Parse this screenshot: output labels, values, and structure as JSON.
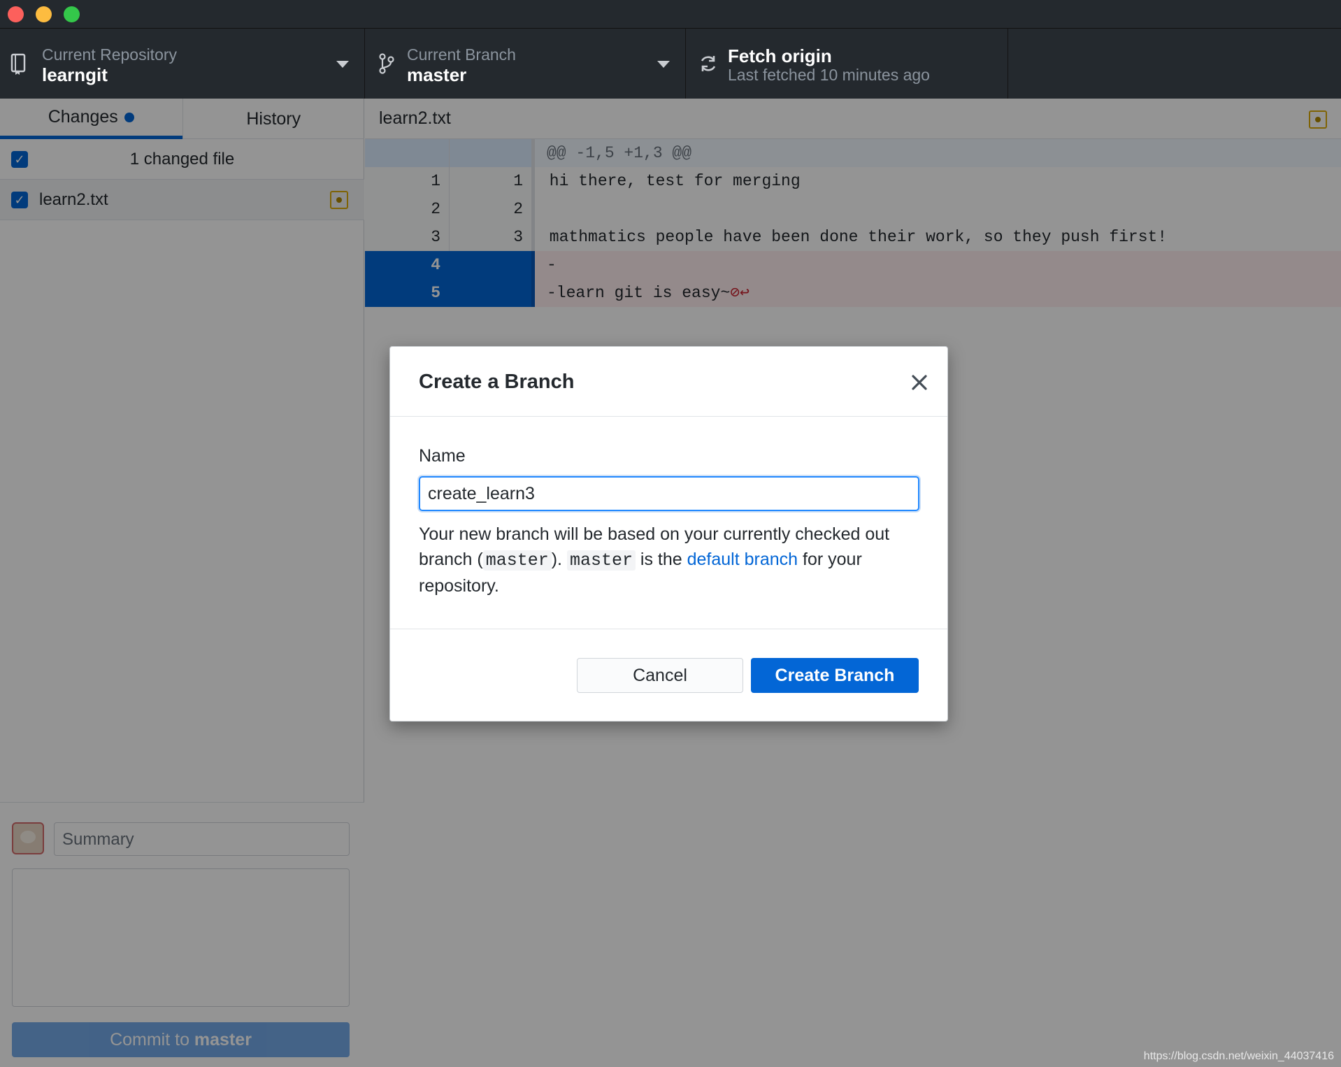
{
  "toolbar": {
    "repo_label": "Current Repository",
    "repo_value": "learngit",
    "branch_label": "Current Branch",
    "branch_value": "master",
    "fetch_title": "Fetch origin",
    "fetch_subtitle": "Last fetched 10 minutes ago"
  },
  "sidebar": {
    "tabs": [
      {
        "label": "Changes"
      },
      {
        "label": "History"
      }
    ],
    "changes_count": "1 changed file",
    "files": [
      {
        "name": "learn2.txt"
      }
    ],
    "summary_placeholder": "Summary",
    "commit_prefix": "Commit to ",
    "commit_branch": "master"
  },
  "diff": {
    "filename": "learn2.txt",
    "hunk": "@@ -1,5 +1,3 @@",
    "lines": [
      {
        "old": "1",
        "new": "1",
        "text": " hi there, test for merging"
      },
      {
        "old": "2",
        "new": "2",
        "text": ""
      },
      {
        "old": "3",
        "new": "3",
        "text": " mathmatics people have been done their work, so they push first!"
      },
      {
        "old": "4",
        "new": "",
        "text": "-"
      },
      {
        "old": "5",
        "new": "",
        "text": "-learn git is easy~"
      }
    ],
    "no_newline_marker": "⊘↩"
  },
  "dialog": {
    "title": "Create a Branch",
    "name_label": "Name",
    "name_value": "create_learn3",
    "help_1": "Your new branch will be based on your currently checked out branch (",
    "help_code_1": "master",
    "help_2": "). ",
    "help_code_2": "master",
    "help_3": " is the ",
    "help_link": "default branch",
    "help_4": " for your repository.",
    "cancel_label": "Cancel",
    "create_label": "Create Branch"
  },
  "watermark": "https://blog.csdn.net/weixin_44037416"
}
